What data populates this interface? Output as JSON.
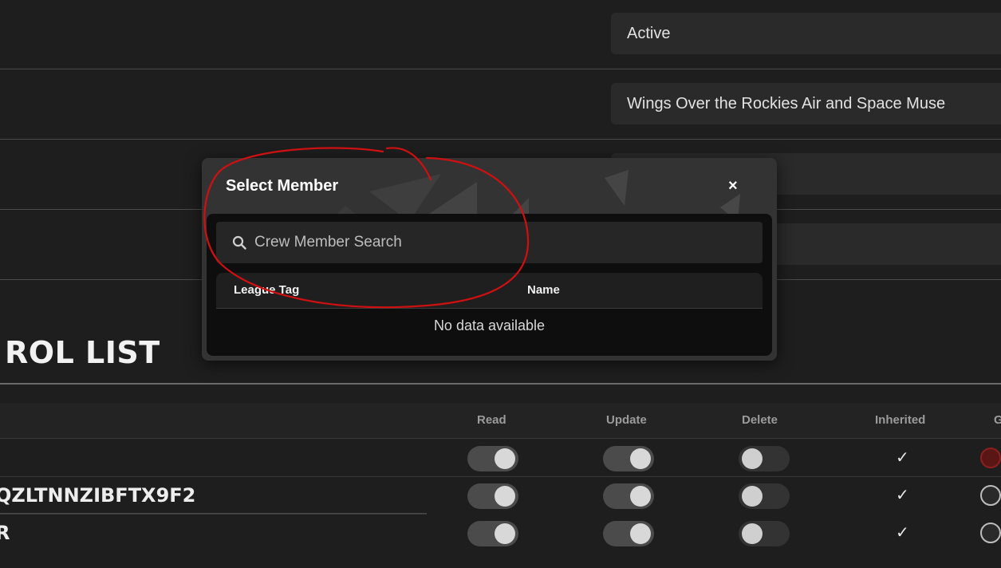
{
  "fields": {
    "status_value": "Active",
    "organization_value": "Wings Over the Rockies Air and Space Muse"
  },
  "section": {
    "title": "ROL LIST"
  },
  "table": {
    "columns": [
      "Read",
      "Update",
      "Delete",
      "Inherited",
      "G"
    ],
    "rows": [
      {
        "label": "",
        "read": true,
        "update": true,
        "delete": false,
        "inherited": true,
        "g_selected": true
      },
      {
        "label": "QZLTNNZIBFTX9F2",
        "read": true,
        "update": true,
        "delete": false,
        "inherited": true,
        "g_selected": false
      },
      {
        "label": "R",
        "read": true,
        "update": true,
        "delete": false,
        "inherited": true,
        "g_selected": false
      }
    ],
    "check_glyph": "✓"
  },
  "modal": {
    "title": "Select Member",
    "close_label": "×",
    "search_placeholder": "Crew Member Search",
    "columns": [
      "League Tag",
      "Name"
    ],
    "empty_text": "No data available"
  },
  "colors": {
    "background": "#1e1e1e",
    "modal": "#333333",
    "annotation": "#d01010"
  },
  "icons": {
    "search": "search-icon",
    "close": "close-icon",
    "check": "checkmark-icon"
  }
}
